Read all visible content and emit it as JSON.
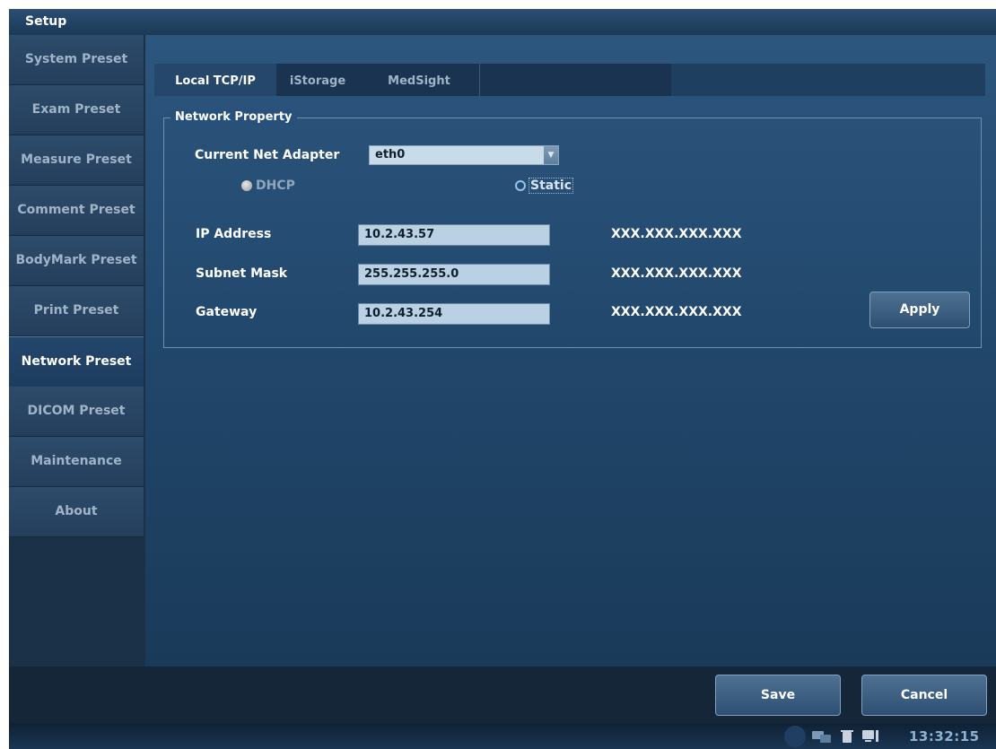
{
  "window": {
    "title": "Setup"
  },
  "sidebar": {
    "items": [
      {
        "label": "System Preset"
      },
      {
        "label": "Exam Preset"
      },
      {
        "label": "Measure Preset"
      },
      {
        "label": "Comment Preset"
      },
      {
        "label": "BodyMark Preset"
      },
      {
        "label": "Print Preset"
      },
      {
        "label": "Network Preset",
        "active": true
      },
      {
        "label": "DICOM Preset"
      },
      {
        "label": "Maintenance"
      },
      {
        "label": "About"
      }
    ]
  },
  "tabs": [
    {
      "label": "Local TCP/IP",
      "active": true
    },
    {
      "label": "iStorage"
    },
    {
      "label": "MedSight"
    }
  ],
  "network_property": {
    "group_title": "Network Property",
    "adapter_label": "Current Net Adapter",
    "adapter_value": "eth0",
    "dhcp_label": "DHCP",
    "static_label": "Static",
    "selected_mode": "Static",
    "ip_label": "IP Address",
    "ip_value": "10.2.43.57",
    "ip_hint": "XXX.XXX.XXX.XXX",
    "subnet_label": "Subnet Mask",
    "subnet_value": "255.255.255.0",
    "subnet_hint": "XXX.XXX.XXX.XXX",
    "gateway_label": "Gateway",
    "gateway_value": "10.2.43.254",
    "gateway_hint": "XXX.XXX.XXX.XXX",
    "apply_label": "Apply"
  },
  "footer": {
    "save_label": "Save",
    "cancel_label": "Cancel"
  },
  "status": {
    "time": "13:32:15"
  },
  "colors": {
    "accent": "#2d567e",
    "background": "#1d3147"
  }
}
